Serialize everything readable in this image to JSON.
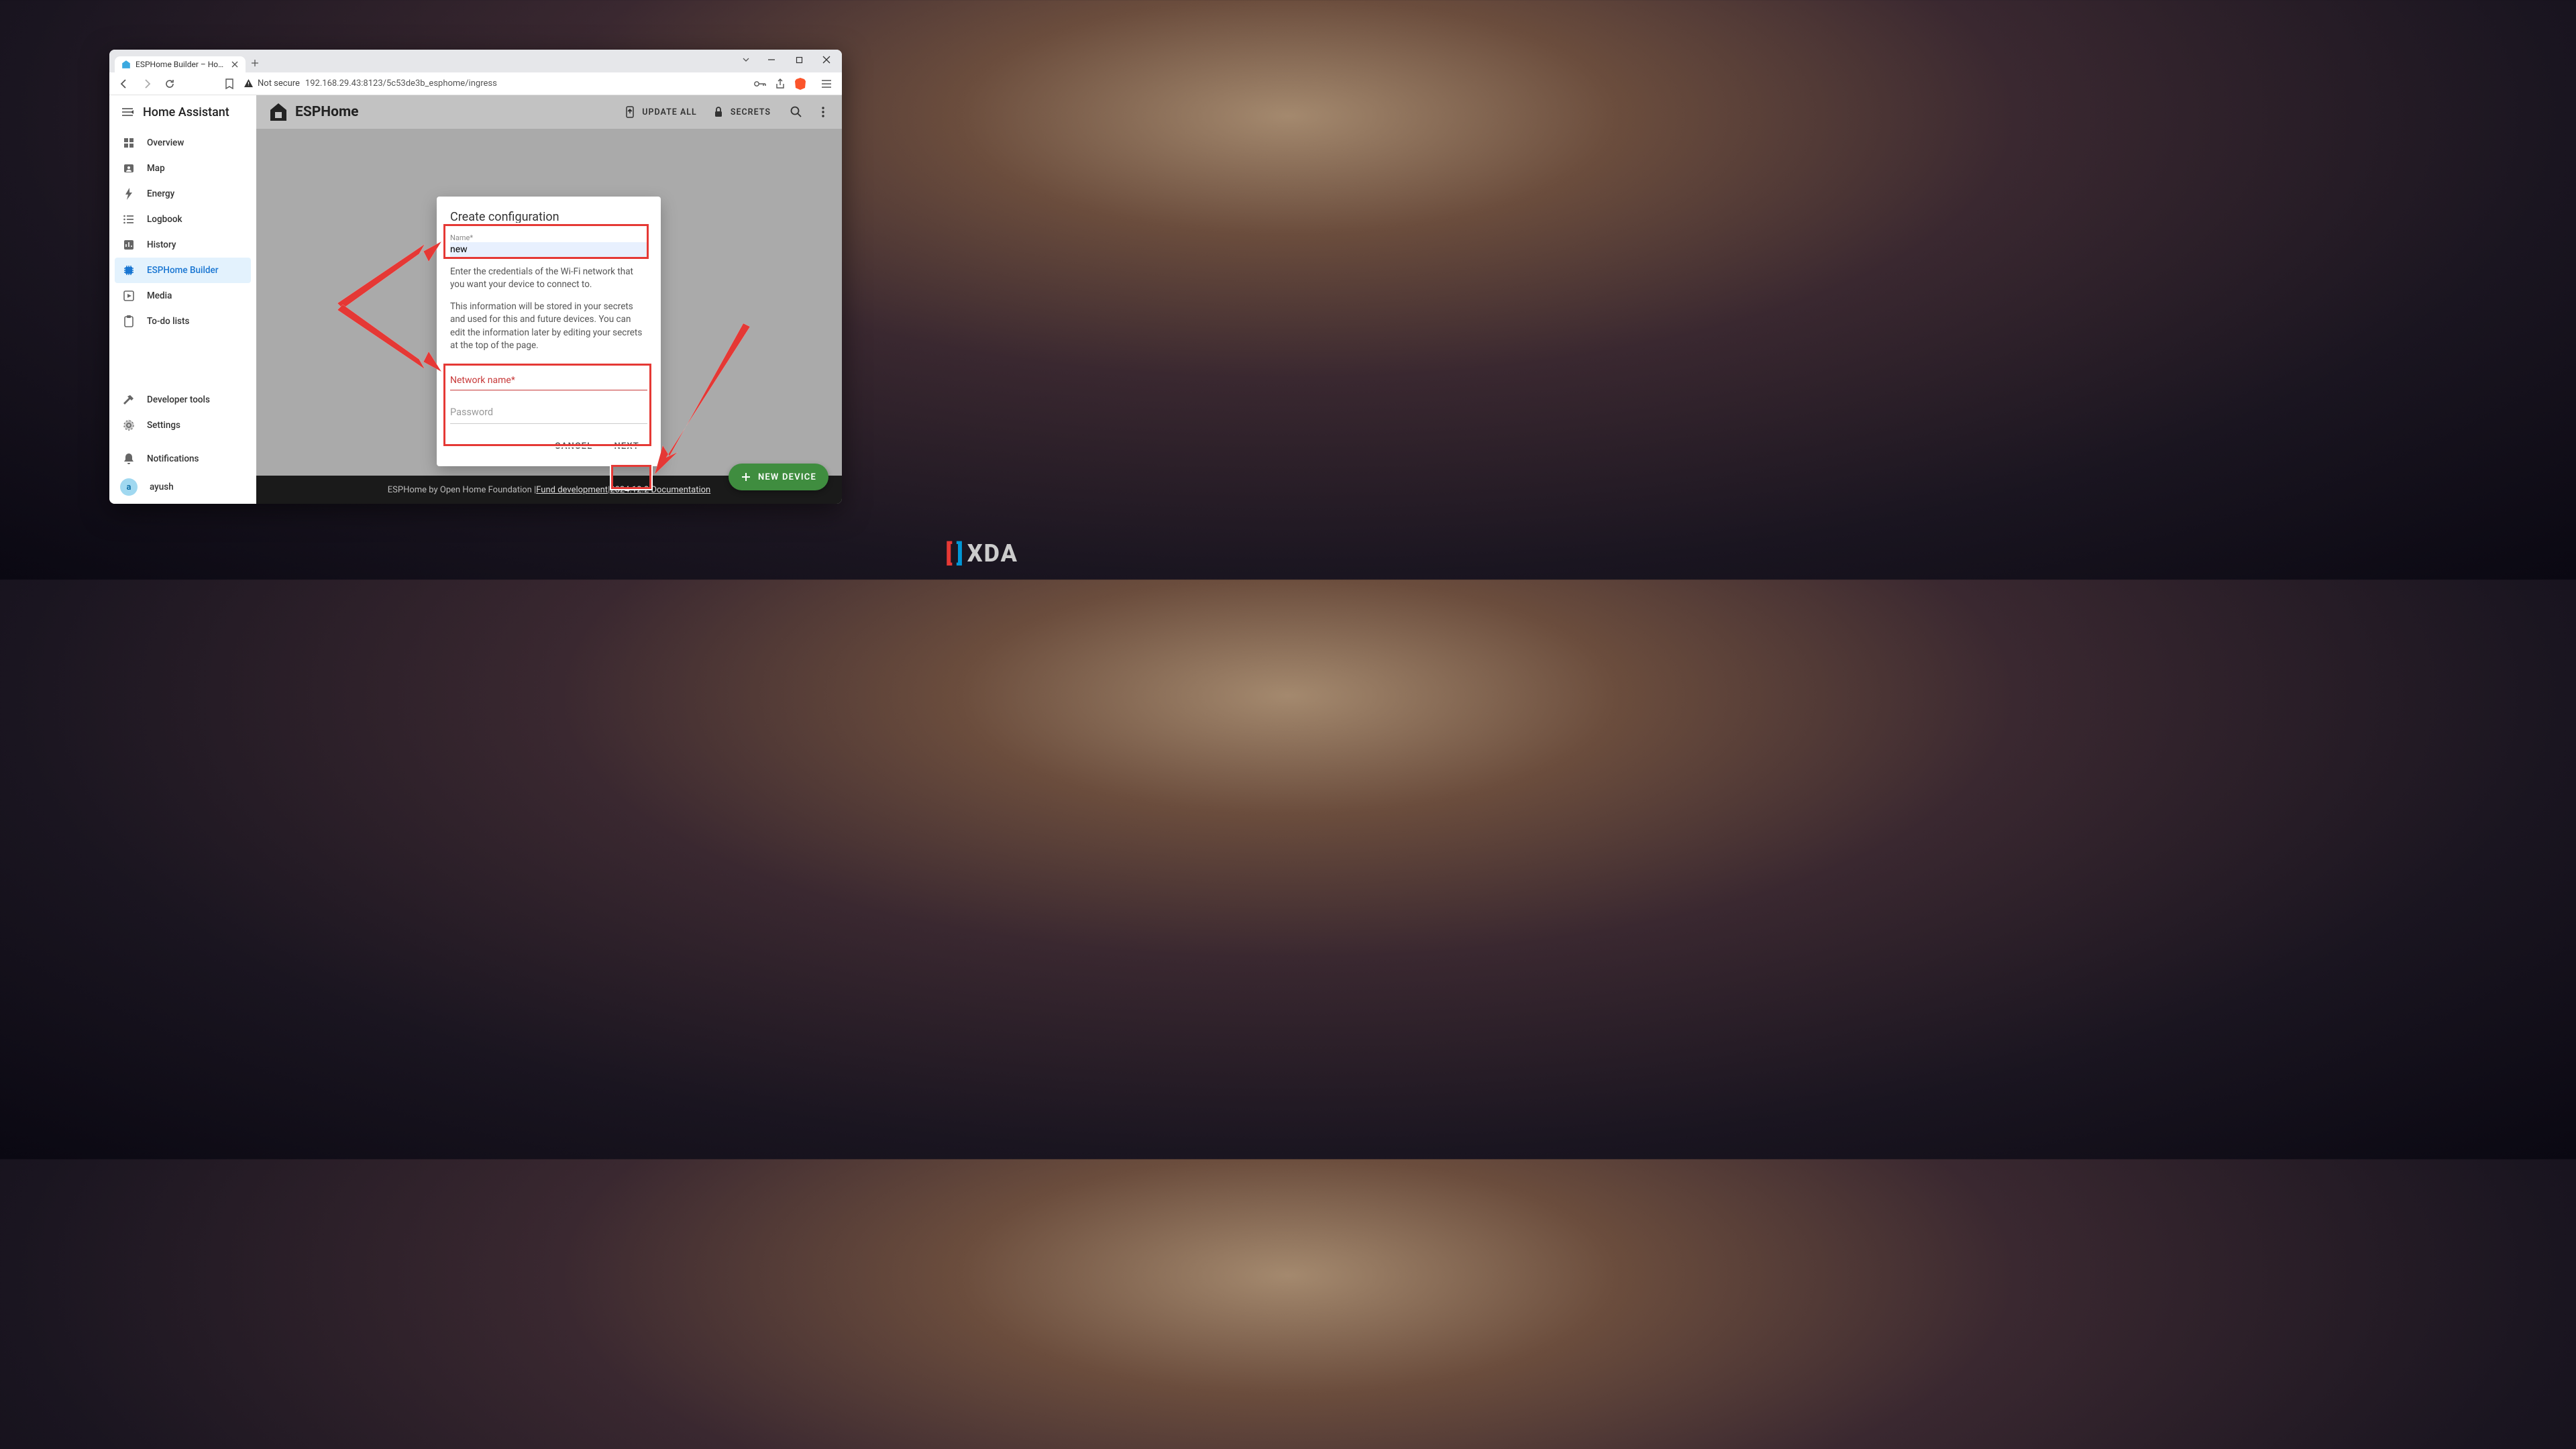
{
  "browser": {
    "tab_title": "ESPHome Builder – Home Assis",
    "not_secure": "Not secure",
    "url": "192.168.29.43:8123/5c53de3b_esphome/ingress"
  },
  "sidebar": {
    "title": "Home Assistant",
    "items": [
      {
        "label": "Overview"
      },
      {
        "label": "Map"
      },
      {
        "label": "Energy"
      },
      {
        "label": "Logbook"
      },
      {
        "label": "History"
      },
      {
        "label": "ESPHome Builder"
      },
      {
        "label": "Media"
      },
      {
        "label": "To-do lists"
      }
    ],
    "bottom": [
      {
        "label": "Developer tools"
      },
      {
        "label": "Settings"
      },
      {
        "label": "Notifications"
      }
    ],
    "user": {
      "initial": "a",
      "name": "ayush"
    }
  },
  "topbar": {
    "brand": "ESPHome",
    "update_all": "UPDATE ALL",
    "secrets": "SECRETS"
  },
  "modal": {
    "title": "Create configuration",
    "name_label": "Name",
    "name_value": "new",
    "desc1": "Enter the credentials of the Wi-Fi network that you want your device to connect to.",
    "desc2": "This information will be stored in your secrets and used for this and future devices. You can edit the information later by editing your secrets at the top of the page.",
    "network_label": "Network name*",
    "password_label": "Password",
    "cancel": "CANCEL",
    "next": "NEXT"
  },
  "footer": {
    "pre": "ESPHome by Open Home Foundation | ",
    "link1": "Fund development",
    "sep": " | ",
    "link2": "2024.12.2 Documentation"
  },
  "fab": "NEW DEVICE",
  "watermark": "XDA"
}
